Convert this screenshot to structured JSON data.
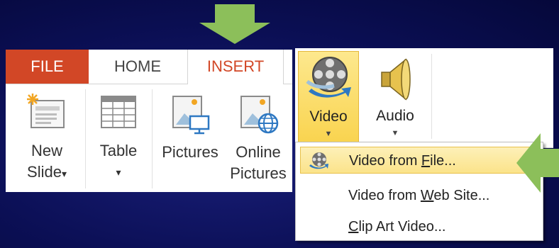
{
  "tabs": {
    "file": "FILE",
    "home": "HOME",
    "insert": "INSERT"
  },
  "left_buttons": {
    "new_slide": {
      "line1": "New",
      "line2": "Slide",
      "caret": "▾"
    },
    "table": {
      "line1": "Table",
      "caret": "▾"
    },
    "pictures": {
      "line1": "Pictures"
    },
    "online_pictures": {
      "line1": "Online",
      "line2": "Pictures"
    }
  },
  "right_buttons": {
    "video": {
      "label": "Video",
      "caret": "▼"
    },
    "audio": {
      "label": "Audio",
      "caret": "▼"
    }
  },
  "dropdown": {
    "items": [
      {
        "pre": "Video from ",
        "u": "F",
        "post": "ile..."
      },
      {
        "pre": "Video from ",
        "u": "W",
        "post": "eb Site..."
      },
      {
        "pre": "",
        "u": "C",
        "post": "lip Art Video..."
      }
    ]
  },
  "colors": {
    "file_tab": "#d24726",
    "insert_text": "#d24726",
    "highlight": "#f9d34d",
    "arrow": "#8cbf5a",
    "background": "#0b0f55"
  },
  "icons": [
    "arrow-down-icon",
    "arrow-left-icon",
    "new-slide-icon",
    "table-icon",
    "pictures-icon",
    "online-pictures-icon",
    "film-reel-icon",
    "speaker-icon"
  ]
}
